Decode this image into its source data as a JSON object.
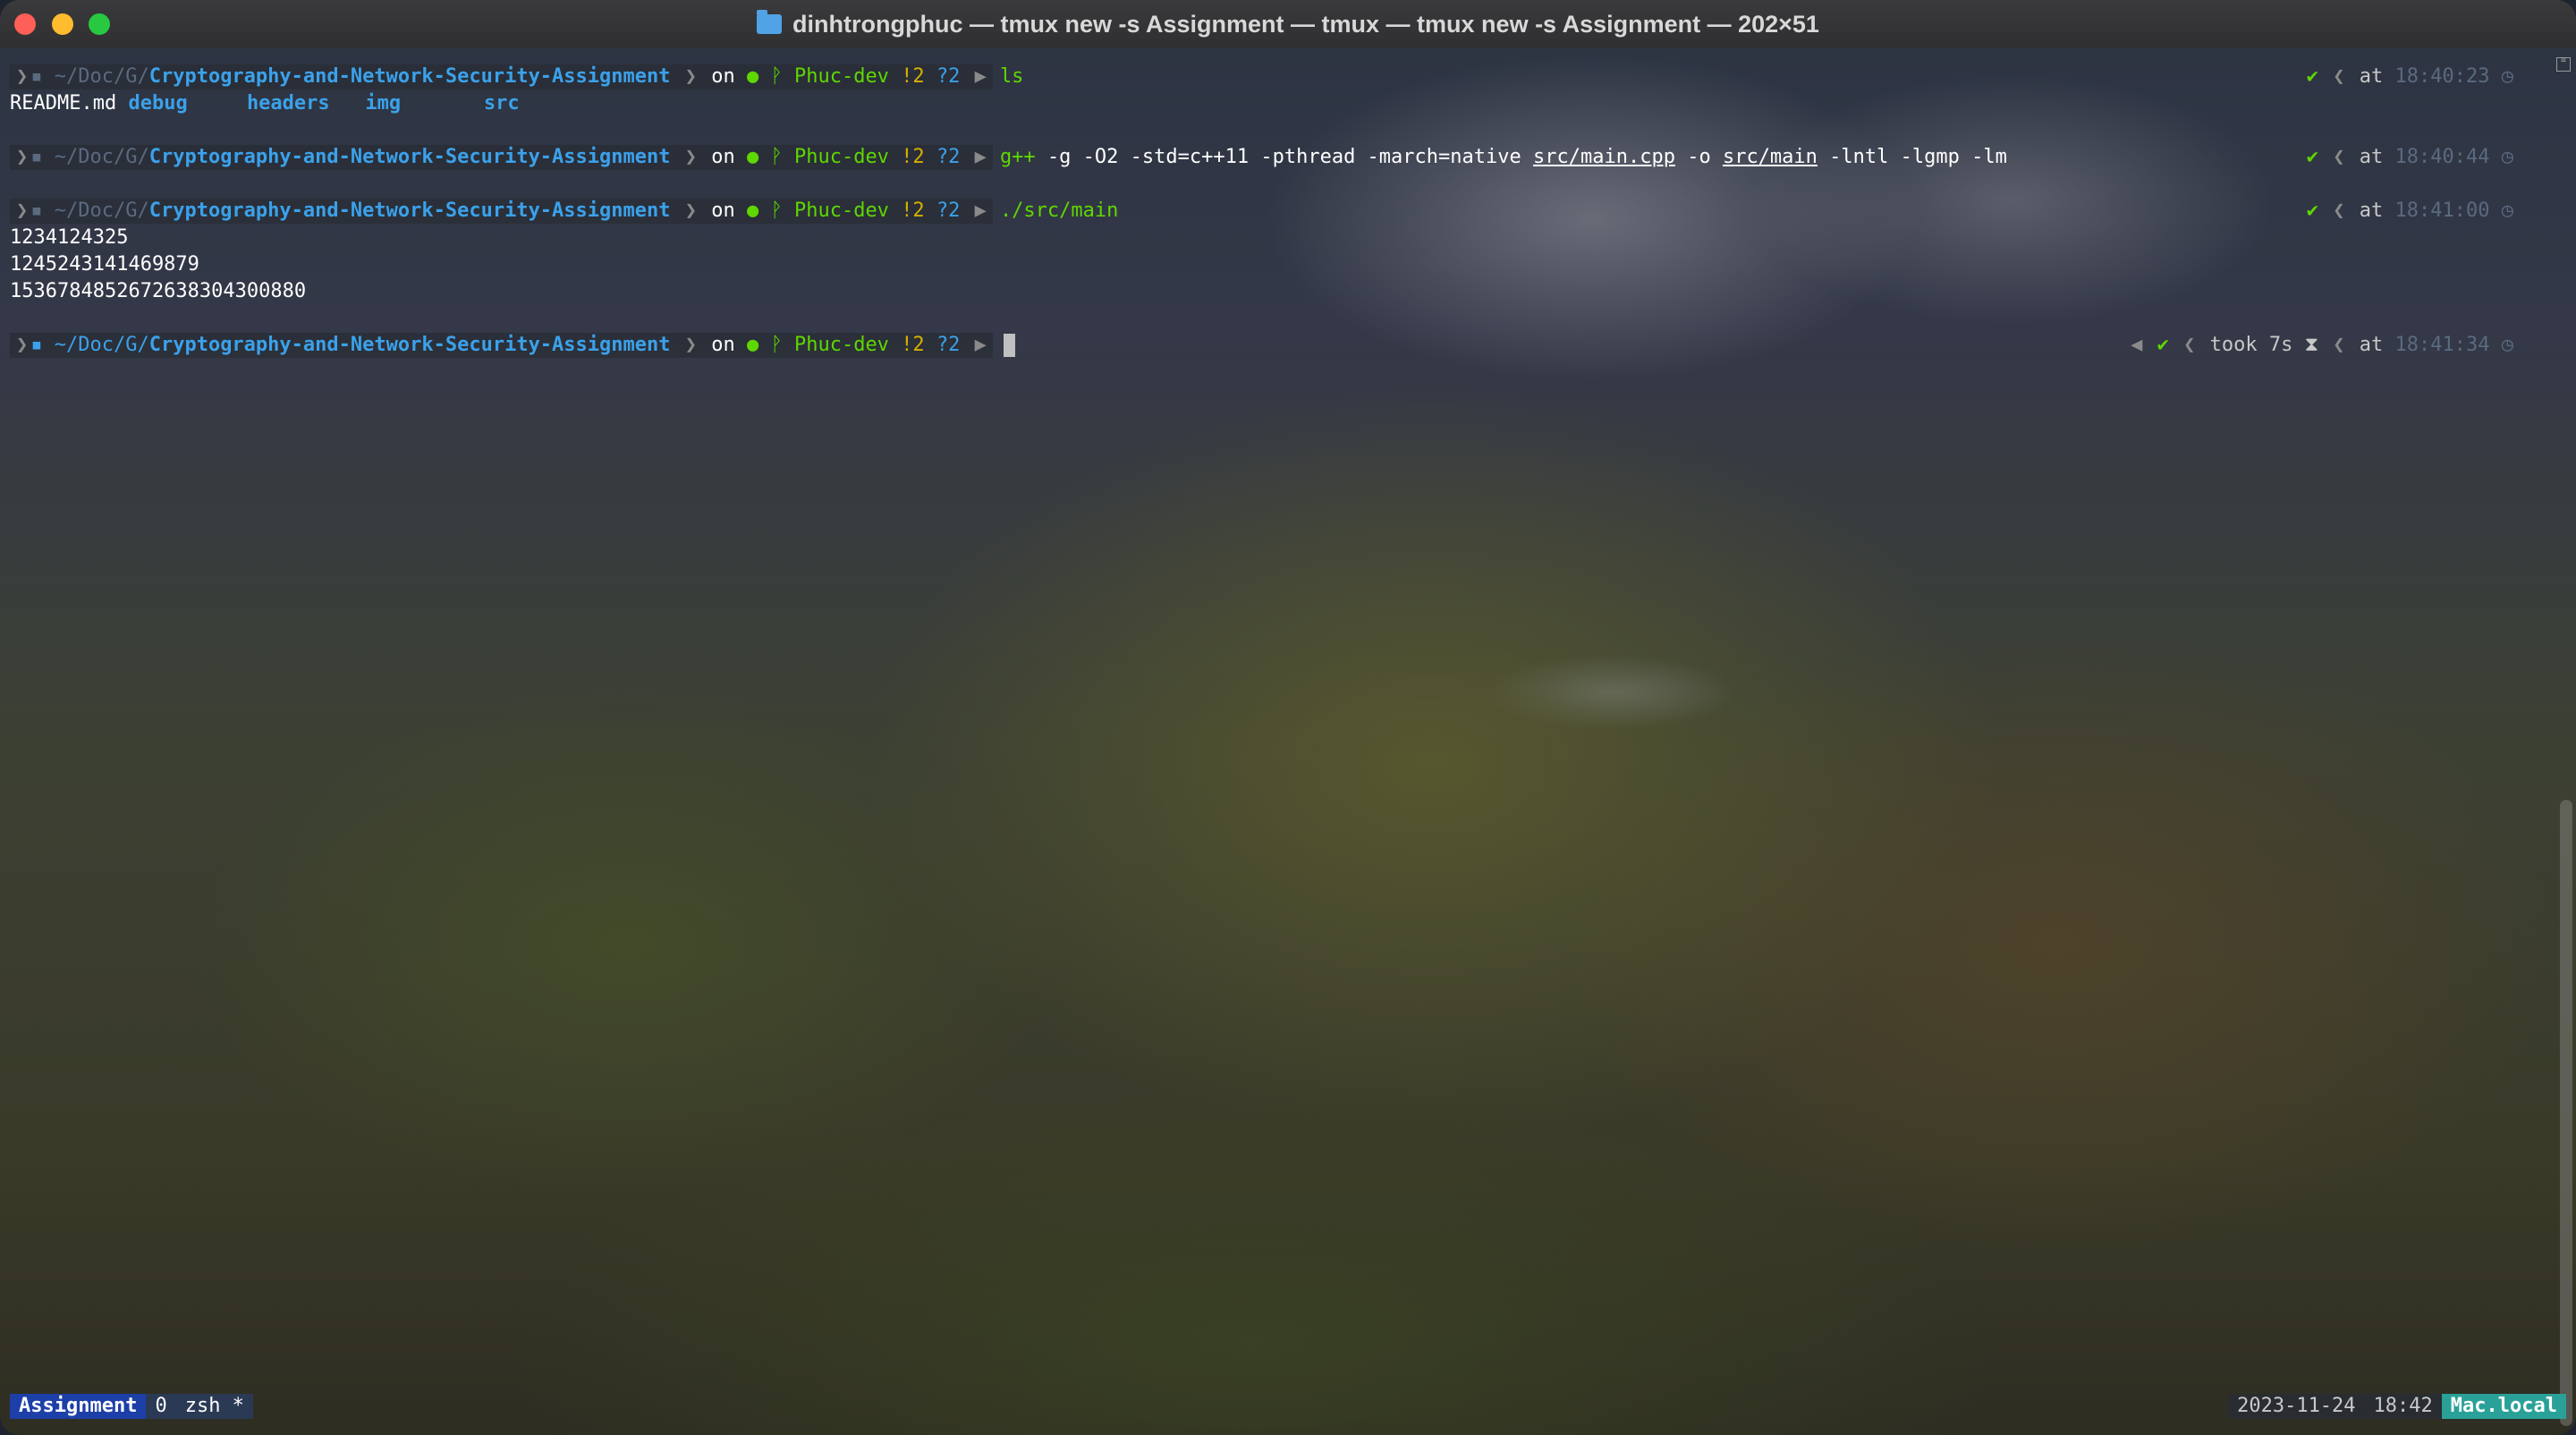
{
  "window": {
    "title": "dinhtrongphuc — tmux new -s Assignment — tmux — tmux new -s Assignment — 202×51"
  },
  "prompt": {
    "home": "~",
    "path_short": "/Doc/G/",
    "repo": "Cryptography-and-Network-Security-Assignment",
    "on": "on",
    "branch": "Phuc-dev",
    "modified": "!2",
    "untracked": "?2",
    "at": "at",
    "check": "✔"
  },
  "lines": [
    {
      "command": "ls",
      "time": "18:40:23",
      "output": [
        "README.md",
        "debug",
        "headers",
        "img",
        "src"
      ]
    },
    {
      "command_parts": [
        "g++",
        "-g -O2 -std=c++11 -pthread -march=native",
        "src/main.cpp",
        "-o",
        "src/main",
        "-lntl -lgmp -lm"
      ],
      "time": "18:40:44"
    },
    {
      "command": "./src/main",
      "time": "18:41:00",
      "output": [
        "1234124325",
        "1245243141469879",
        "1536784852672638304300880"
      ]
    },
    {
      "took": "took 7s",
      "time": "18:41:34"
    }
  ],
  "status_bar": {
    "session": "Assignment",
    "window_index": "0",
    "window_name": "zsh *",
    "date": "2023-11-24",
    "time": "18:42",
    "host": "Mac.local"
  },
  "colors": {
    "accent_blue": "#3ba1ea",
    "git_green": "#5fd700",
    "git_status_yellow": "#d7af00",
    "session_bg": "#1d3fa8",
    "host_bg": "#2aa198"
  }
}
